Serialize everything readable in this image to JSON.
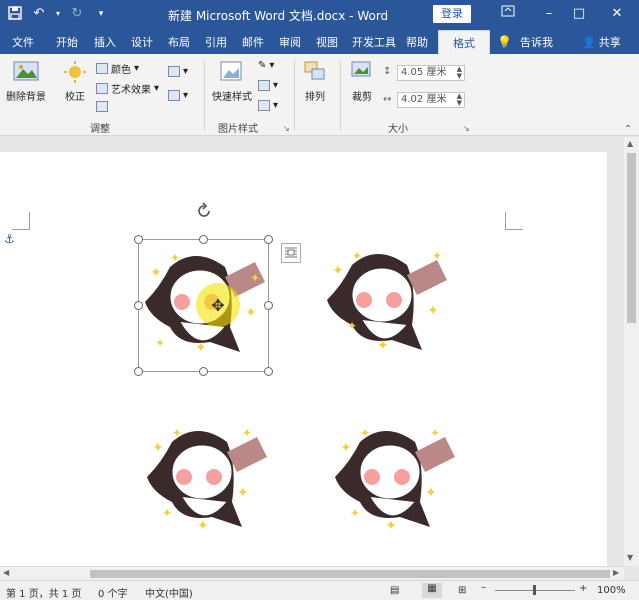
{
  "titlebar": {
    "title": "新建 Microsoft Word 文档.docx  -  Word",
    "login": "登录",
    "minimize": "–",
    "restore": "□",
    "close": "✕"
  },
  "tabs": {
    "items": [
      "文件",
      "开始",
      "插入",
      "设计",
      "布局",
      "引用",
      "邮件",
      "审阅",
      "视图",
      "开发工具",
      "帮助",
      "格式"
    ],
    "active": "格式",
    "tellme": "告诉我",
    "share": "共享"
  },
  "ribbon": {
    "remove_bg": "删除背景",
    "correct": "校正",
    "color": "颜色",
    "artistic": "艺术效果",
    "adjust_group": "调整",
    "quick_styles": "快速样式",
    "picture_styles_group": "图片样式",
    "arrange": "排列",
    "crop": "裁剪",
    "height": "4.05 厘米",
    "width": "4.02 厘米",
    "size_group": "大小"
  },
  "statusbar": {
    "page": "第 1 页，共 1 页",
    "words": "0 个字",
    "language": "中文(中国)",
    "zoom": "100%"
  },
  "colors": {
    "brand": "#2b579a",
    "sparkle": "#f2d23c"
  }
}
